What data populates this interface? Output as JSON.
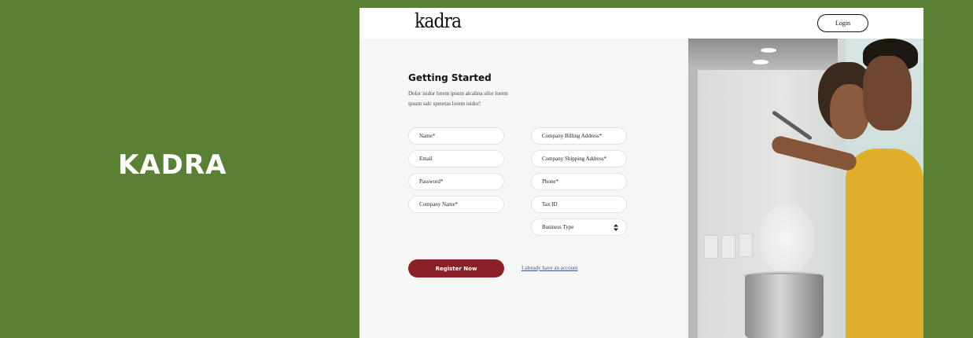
{
  "banner": {
    "title": "KADRA"
  },
  "header": {
    "logo": "kadra",
    "login_label": "Login"
  },
  "form": {
    "title": "Getting Started",
    "description": "Dolor isidor lorem ipsum alcalina silor lorem ipsum salc spreetas lorem isidor!",
    "left_fields": [
      {
        "placeholder": "Name*"
      },
      {
        "placeholder": "Email"
      },
      {
        "placeholder": "Password*"
      },
      {
        "placeholder": "Company Name*"
      }
    ],
    "right_fields": [
      {
        "placeholder": "Company Billing Address*"
      },
      {
        "placeholder": "Company Shipping Address*"
      },
      {
        "placeholder": "Phone*"
      },
      {
        "placeholder": "Tax ID"
      }
    ],
    "business_type": {
      "selected": "Business Type"
    },
    "register_label": "Register Now",
    "account_link": "I already have an account"
  },
  "colors": {
    "background": "#5a8034",
    "register_button": "#8b2026",
    "link": "#3a5b8a"
  },
  "icons": {
    "select_caret": "sort-caret-icon"
  }
}
